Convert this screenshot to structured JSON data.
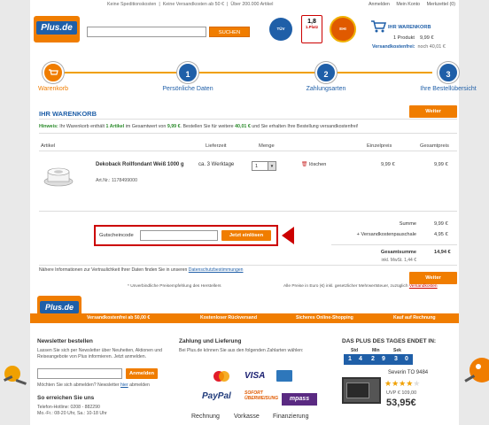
{
  "topbar": {
    "promo": [
      "Keine Speditionskosten",
      "Keine Versandkosten ab 50 €",
      "Über 200.000 Artikel"
    ],
    "account": [
      "Anmelden",
      "Mein Konto",
      "Merkzettel (0)"
    ]
  },
  "logo": {
    "text": "Plus.de"
  },
  "search": {
    "placeholder": "",
    "button": "SUCHEN"
  },
  "seals": {
    "tuv": "TÜV",
    "tested_grade": "1,8",
    "tested_label": "1.Platz",
    "ehi": "EHI"
  },
  "cart": {
    "title": "IHR WARENKORB",
    "count": "1 Produkt",
    "total": "9,99 €",
    "ship_label": "Versandkostenfrei:",
    "ship_value": "noch 40,01 €"
  },
  "steps": [
    {
      "num": "",
      "label": "Warenkorb"
    },
    {
      "num": "1",
      "label": "Persönliche Daten"
    },
    {
      "num": "2",
      "label": "Zahlungsarten"
    },
    {
      "num": "3",
      "label": "Ihre Bestellübersicht"
    }
  ],
  "basket": {
    "title": "IHR WARENKORB",
    "next": "Weiter",
    "hint_label": "Hinweis:",
    "hint_text_1": "Ihr Warenkorb enthält",
    "hint_items": "1 Artikel",
    "hint_text_2": "im Gesamtwert von",
    "hint_value": "9,99 €",
    "hint_text_3": ". Bestellen Sie für weitere",
    "hint_remaining": "40,01 €",
    "hint_text_4": "und Sie erhalten Ihre Bestellung versandkostenfrei!",
    "columns": [
      "Artikel",
      "Lieferzeit",
      "Menge",
      "Einzelpreis",
      "Gesamtpreis"
    ],
    "item": {
      "name": "Dekoback Rollfondant Weiß 1000 g",
      "art_nr": "Art.Nr.: 1178499000",
      "delivery": "ca. 3 Werktage",
      "quantity": "1",
      "remove": "löschen",
      "unit_price": "9,99 €",
      "total_price": "9,99 €"
    },
    "voucher": {
      "label": "Gutscheincode",
      "button": "Jetzt einlösen"
    },
    "sums": {
      "sum_label": "Summe",
      "sum_value": "9,99 €",
      "ship_label": "+ Versandkostenpauschale",
      "ship_value": "4,95 €",
      "total_label": "Gesamtsumme",
      "total_value": "14,94 €",
      "vat": "inkl. MwSt. 1,44 €"
    },
    "privacy_text": "Nähere Informationen zur Vertraulichkeit Ihrer Daten finden Sie in unseren",
    "privacy_link": "Datenschutzbestimmungen",
    "note_left": "* Unverbindliche Preisempfehlung des Herstellers",
    "note_right": "Alle Preise in Euro (€) inkl. gesetzlicher Mehrwertsteuer, zuzüglich",
    "note_link": "Versandkosten"
  },
  "footer": {
    "logo": "Plus.de",
    "band": [
      "Versandkostenfrei ab 50,00 €",
      "Kostenloser Rückversand",
      "Sicheres Online-Shopping",
      "Kauf auf Rechnung"
    ],
    "newsletter": {
      "title": "Newsletter bestellen",
      "text": "Lassen Sie sich per Newsletter über Neuheiten, Aktionen und Reiseangebote von Plus informieren. Jetzt anmelden.",
      "button": "Anmelden",
      "unsub_q": "Möchten Sie sich abmelden? Newsletter",
      "unsub_link": "hier",
      "unsub_end": "abmelden",
      "reach_title": "So erreichen Sie uns",
      "hotline": "Telefon-Hotline: 0208 - 882290",
      "hours": "Mo.-Fr.: 08-20 Uhr, Sa.: 10-18 Uhr"
    },
    "payment": {
      "title": "Zahlung und Lieferung",
      "text": "Bei Plus.de können Sie aus den folgenden Zahlarten wählen:",
      "logos": [
        "VISA",
        "PayPal",
        "SOFORT ÜBERWEISUNG",
        "mpass"
      ],
      "methods": [
        "Rechnung",
        "Vorkasse",
        "Finanzierung"
      ]
    },
    "deal": {
      "title": "DAS PLUS DES TAGES ENDET IN:",
      "labels": [
        "Std",
        "Min",
        "Sek"
      ],
      "digits": [
        "1",
        "4",
        "2",
        "9",
        "3",
        "0"
      ],
      "product": "Severin TO 9484",
      "uvp": "UVP € 109,00",
      "price": "53,95€"
    }
  }
}
